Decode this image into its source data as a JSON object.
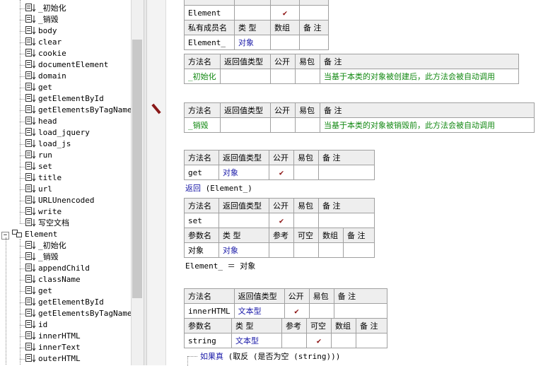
{
  "tree": {
    "items": [
      {
        "label": "_初始化",
        "type": "method"
      },
      {
        "label": "_销毁",
        "type": "method"
      },
      {
        "label": "body",
        "type": "method"
      },
      {
        "label": "clear",
        "type": "method"
      },
      {
        "label": "cookie",
        "type": "method"
      },
      {
        "label": "documentElement",
        "type": "method"
      },
      {
        "label": "domain",
        "type": "method"
      },
      {
        "label": "get",
        "type": "method"
      },
      {
        "label": "getElementById",
        "type": "method"
      },
      {
        "label": "getElementsByTagName",
        "type": "method"
      },
      {
        "label": "head",
        "type": "method"
      },
      {
        "label": "load_jquery",
        "type": "method"
      },
      {
        "label": "load_js",
        "type": "method"
      },
      {
        "label": "run",
        "type": "method"
      },
      {
        "label": "set",
        "type": "method"
      },
      {
        "label": "title",
        "type": "method"
      },
      {
        "label": "url",
        "type": "method"
      },
      {
        "label": "URLUnencoded",
        "type": "method"
      },
      {
        "label": "write",
        "type": "method"
      },
      {
        "label": "写空文档",
        "type": "method"
      },
      {
        "label": "Element",
        "type": "class"
      },
      {
        "label": "_初始化",
        "type": "method"
      },
      {
        "label": "_销毁",
        "type": "method"
      },
      {
        "label": "appendChild",
        "type": "method"
      },
      {
        "label": "className",
        "type": "method"
      },
      {
        "label": "get",
        "type": "method"
      },
      {
        "label": "getElementById",
        "type": "method"
      },
      {
        "label": "getElementsByTagName",
        "type": "method"
      },
      {
        "label": "id",
        "type": "method"
      },
      {
        "label": "innerHTML",
        "type": "method"
      },
      {
        "label": "innerText",
        "type": "method"
      },
      {
        "label": "outerHTML",
        "type": "method"
      }
    ]
  },
  "h": {
    "method": "方法名",
    "ret": "返回值类型",
    "pub": "公开",
    "easy": "易包",
    "note": "备 注",
    "member": "私有成员名",
    "type": "类 型",
    "arr": "数组",
    "param": "参数名",
    "ref": "参考",
    "null": "可空"
  },
  "check": "✔",
  "code": {
    "class_row": {
      "name": "Element"
    },
    "member_row": {
      "name": "Element_",
      "type": "对象"
    },
    "init": {
      "name": "_初始化",
      "note": "当基于本类的对象被创建后，此方法会被自动调用"
    },
    "destroy": {
      "name": "_销毁",
      "note": "当基于本类的对象被销毁前，此方法会被自动调用"
    },
    "get": {
      "name": "get",
      "ret": "对象"
    },
    "return_kw": "返回",
    "return_arg": "(Element_)",
    "set": {
      "name": "set",
      "param": "对象",
      "ptype": "对象"
    },
    "assign_line": "Element_ ＝ 对象",
    "innerHTML": {
      "name": "innerHTML",
      "ret": "文本型",
      "param": "string",
      "ptype": "文本型"
    },
    "if_kw": "如果真",
    "if_rest": "(取反 (是否为空 (string)))"
  }
}
